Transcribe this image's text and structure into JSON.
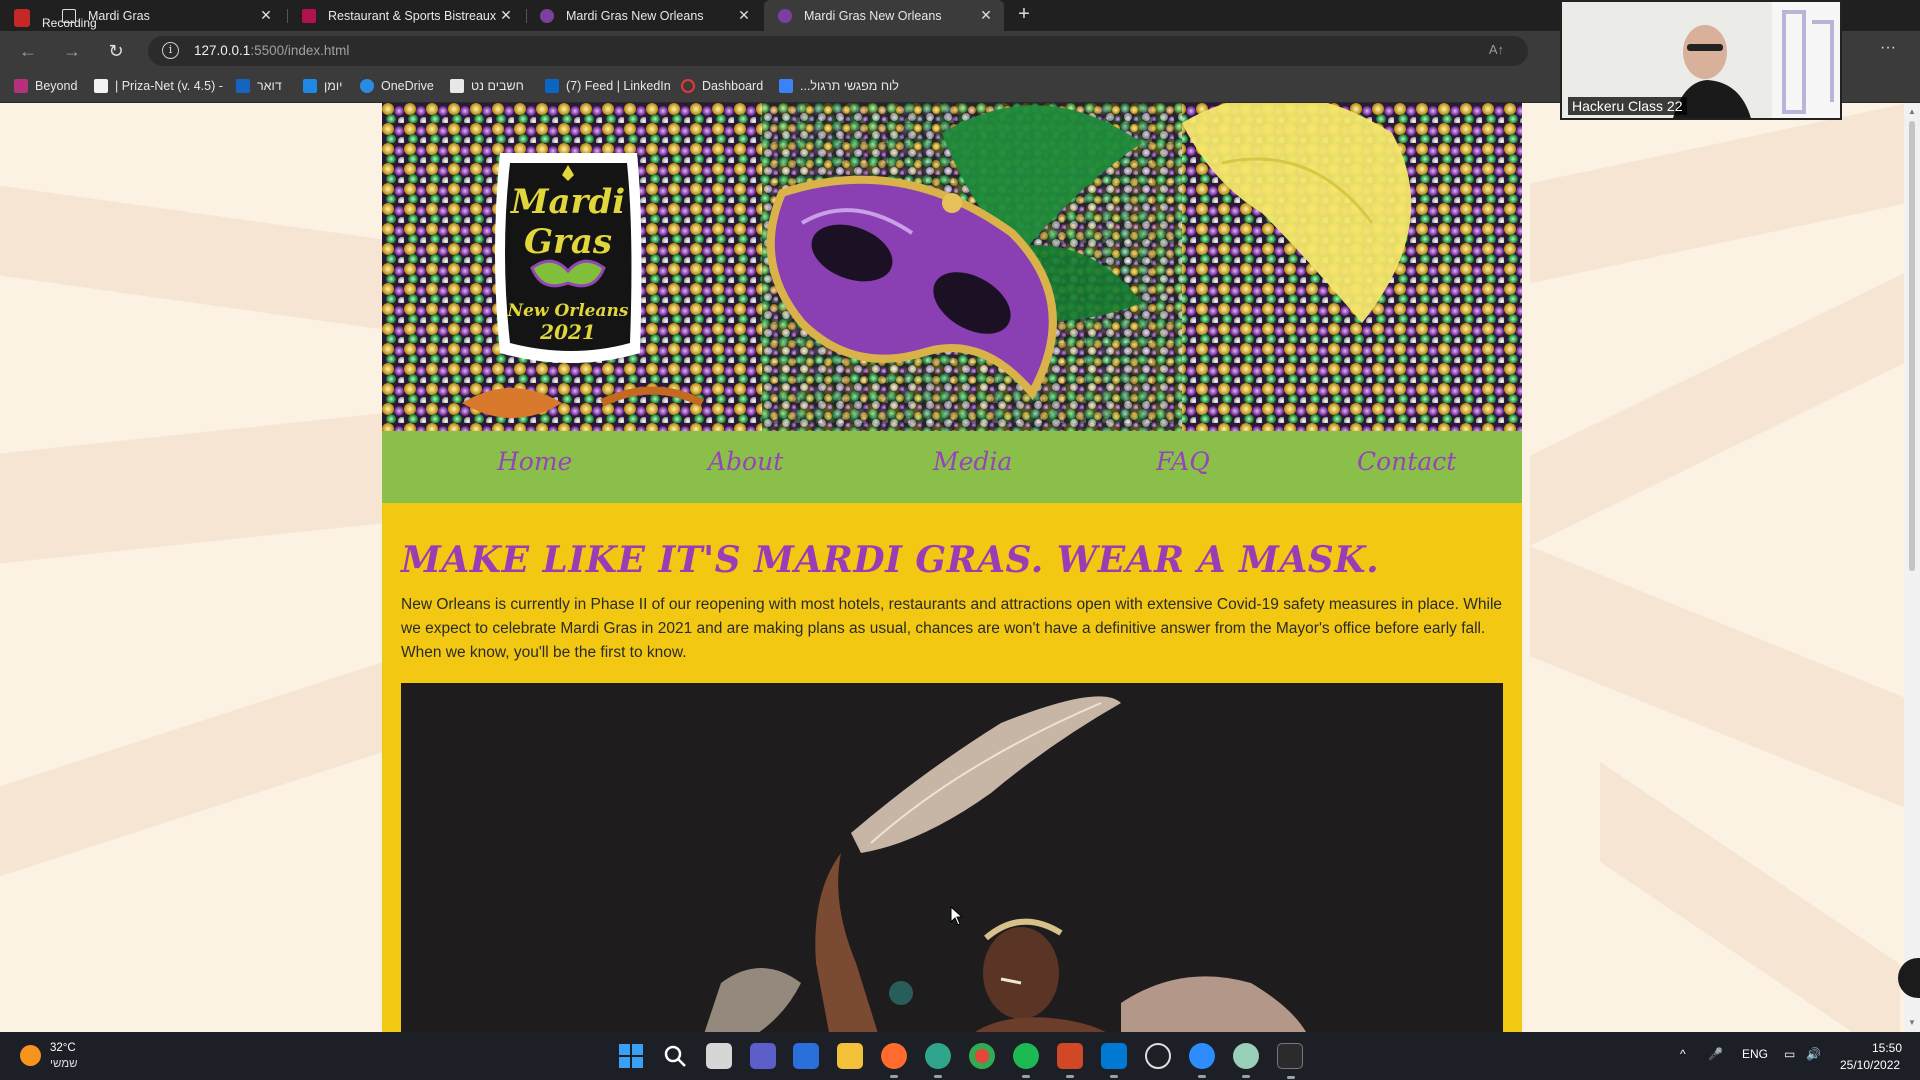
{
  "recording": {
    "label": "Recording"
  },
  "tabs": [
    {
      "title": "Mardi Gras"
    },
    {
      "title": "Restaurant & Sports Bistreaux | \\"
    },
    {
      "title": "Mardi Gras New Orleans"
    },
    {
      "title": "Mardi Gras New Orleans"
    }
  ],
  "address": {
    "host": "127.0.0.1",
    "path": ":5500/index.html",
    "read_aloud": "A↑"
  },
  "bookmarks": [
    {
      "label": "Beyond",
      "color": "#b5317c"
    },
    {
      "label": "| Priza-Net (v. 4.5) -",
      "color": "#f2f2f2"
    },
    {
      "label": "דואר",
      "color": "#1565c0"
    },
    {
      "label": "יומן",
      "color": "#1e88e5"
    },
    {
      "label": "OneDrive",
      "color": "#2b8ae2"
    },
    {
      "label": "חשבים נט",
      "color": "#e8e8e8"
    },
    {
      "label": "(7) Feed | LinkedIn",
      "color": "#0a66c2"
    },
    {
      "label": "Dashboard",
      "color": "#e53935"
    },
    {
      "label": "...לוח מפגשי תרגול",
      "color": "#3b82f6"
    }
  ],
  "site": {
    "logo": {
      "line1": "Mardi",
      "line2": "Gras",
      "line3": "New Orleans",
      "line4": "2021"
    },
    "nav": [
      "Home",
      "About",
      "Media",
      "FAQ",
      "Contact"
    ],
    "headline": "MAKE LIKE IT'S MARDI GRAS. WEAR A MASK.",
    "intro": "New Orleans is currently in Phase II of our reopening with most hotels, restaurants and attractions open with extensive Covid-19 safety measures in place. While we expect to celebrate Mardi Gras in 2021 and are making plans as usual, chances are won't have a definitive answer from the Mayor's office before early fall. When we know, you'll be the first to know.",
    "colors": {
      "nav_bg": "#8ac04a",
      "nav_text": "#9645b8",
      "content_bg": "#f2c813",
      "headline": "#9b3bb5"
    }
  },
  "webcam": {
    "label": "Hackeru Class 22"
  },
  "taskbar": {
    "weather_temp": "32°C",
    "weather_desc": "שמשי",
    "lang": "ENG",
    "time": "15:50",
    "date": "25/10/2022",
    "apps": [
      "windows-start",
      "search",
      "task-view",
      "teams",
      "store",
      "file-explorer",
      "firefox",
      "edge-dev",
      "chrome",
      "spotify",
      "powerpoint",
      "vscode",
      "clock",
      "zoom",
      "edge-profile",
      "terminal"
    ]
  }
}
